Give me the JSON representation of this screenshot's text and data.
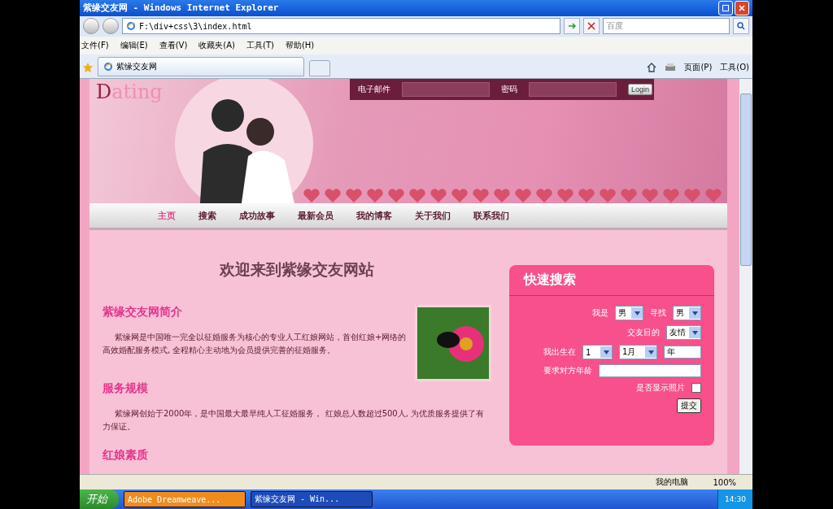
{
  "window": {
    "title": "紫缘交友网 - Windows Internet Explorer"
  },
  "address_bar": {
    "url": "F:\\div+css\\3\\index.html",
    "search_placeholder": "百度"
  },
  "menu": [
    "文件(F)",
    "编辑(E)",
    "查看(V)",
    "收藏夹(A)",
    "工具(T)",
    "帮助(H)"
  ],
  "tab": {
    "label": "紫缘交友网"
  },
  "command_bar": [
    "页面(P)",
    "工具(O)"
  ],
  "site": {
    "logo": "Dating",
    "login": {
      "email_label": "电子邮件",
      "password_label": "密码",
      "button": "Login"
    },
    "nav": [
      {
        "label": "主页",
        "selected": true
      },
      {
        "label": "搜索",
        "selected": false
      },
      {
        "label": "成功故事",
        "selected": false
      },
      {
        "label": "最新会员",
        "selected": false
      },
      {
        "label": "我的博客",
        "selected": false
      },
      {
        "label": "关于我们",
        "selected": false
      },
      {
        "label": "联系我们",
        "selected": false
      }
    ],
    "welcome": "欢迎来到紫缘交友网站",
    "sections": [
      {
        "heading": "紫缘交友网简介",
        "text": "紫缘网是中国唯一完全以征婚服务为核心的专业人工红娘网站，首创红娘+网络的高效婚配服务模式, 全程精心主动地为会员提供完善的征婚服务。"
      },
      {
        "heading": "服务规模",
        "text": "紫缘网创始于2000年，是中国最大最早纯人工征婚服务， 红娘总人数超过500人, 为优质服务提供了有力保证。"
      },
      {
        "heading": "红娘素质"
      }
    ],
    "quick_search": {
      "title": "快速搜索",
      "i_am_label": "我是",
      "i_am": "男",
      "seeking_label": "寻找",
      "seeking": "男",
      "purpose_label": "交友目的",
      "purpose": "友情",
      "born_label": "我出生在",
      "born_day": "1",
      "born_month": "1月",
      "born_year": "年",
      "age_label": "要求对方年龄",
      "photo_label": "是否显示照片",
      "photo_checked": false,
      "submit": "提交"
    }
  },
  "status_bar": {
    "zone": "我的电脑",
    "zoom": "100%"
  },
  "taskbar": {
    "start": "开始",
    "tasks": [
      {
        "label": "Adobe Dreamweave...",
        "selected": false
      },
      {
        "label": "紫缘交友网 - Win...",
        "selected": true
      }
    ],
    "clock": "14:30"
  }
}
